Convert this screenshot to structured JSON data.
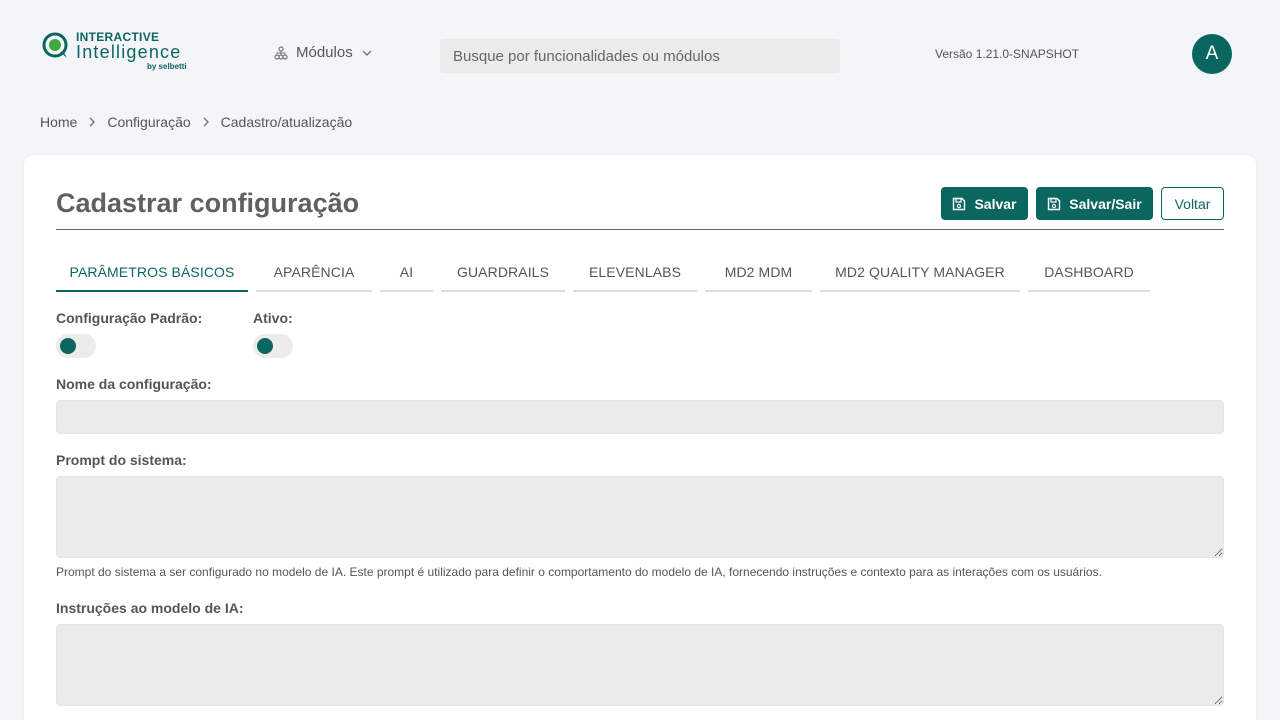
{
  "header": {
    "logo": {
      "top": "INTERACTIVE",
      "main": "Intelligence",
      "by": "by selbetti"
    },
    "modules_label": "Módulos",
    "search_placeholder": "Busque por funcionalidades ou módulos",
    "version": "Versão 1.21.0-SNAPSHOT",
    "avatar_initial": "A"
  },
  "breadcrumb": [
    "Home",
    "Configuração",
    "Cadastro/atualização"
  ],
  "page": {
    "title": "Cadastrar configuração",
    "buttons": {
      "save": "Salvar",
      "save_exit": "Salvar/Sair",
      "back": "Voltar"
    }
  },
  "tabs": [
    {
      "label": "PARÂMETROS BÁSICOS",
      "active": true
    },
    {
      "label": "APARÊNCIA",
      "active": false
    },
    {
      "label": "AI",
      "active": false
    },
    {
      "label": "GUARDRAILS",
      "active": false
    },
    {
      "label": "ELEVENLABS",
      "active": false
    },
    {
      "label": "MD2 MDM",
      "active": false
    },
    {
      "label": "MD2 QUALITY MANAGER",
      "active": false
    },
    {
      "label": "DASHBOARD",
      "active": false
    }
  ],
  "form": {
    "default_config_label": "Configuração Padrão:",
    "active_label": "Ativo:",
    "name_label": "Nome da configuração:",
    "name_value": "",
    "system_prompt_label": "Prompt do sistema:",
    "system_prompt_value": "",
    "system_prompt_hint": "Prompt do sistema a ser configurado no modelo de IA. Este prompt é utilizado para definir o comportamento do modelo de IA, fornecendo instruções e contexto para as interações com os usuários.",
    "instructions_label": "Instruções ao modelo de IA:",
    "instructions_value": ""
  },
  "colors": {
    "accent": "#0c6660",
    "background": "#f4f5f9",
    "input_bg": "#ebebeb"
  },
  "icons": [
    "logo-icon",
    "modules-icon",
    "chevron-down-icon",
    "chevron-right-icon",
    "save-icon"
  ]
}
